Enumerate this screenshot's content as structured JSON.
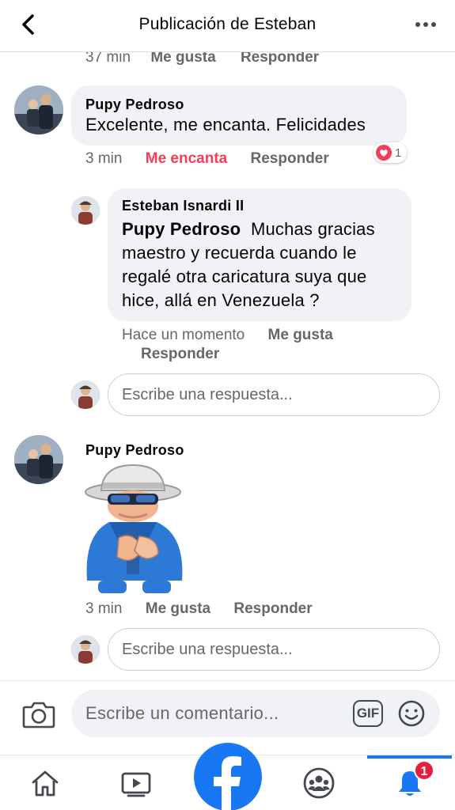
{
  "header": {
    "title": "Publicación de Esteban"
  },
  "top_meta": {
    "time": "37 min",
    "like": "Me gusta",
    "reply": "Responder"
  },
  "comments": [
    {
      "author": "Pupy Pedroso",
      "text": "Excelente, me encanta. Felicidades",
      "time": "3 min",
      "reaction_label": "Me encanta",
      "reply": "Responder",
      "reaction_count": "1"
    },
    {
      "author": "Pupy Pedroso",
      "time": "3 min",
      "like": "Me gusta",
      "reply": "Responder"
    }
  ],
  "reply": {
    "author": "Esteban Isnardi II",
    "mention": "Pupy Pedroso",
    "text": "Muchas gracias maestro y recuerda cuando le regalé otra caricatura suya que hice, allá en Venezuela ?",
    "time": "Hace un momento",
    "like": "Me gusta",
    "reply": "Responder"
  },
  "reply_inputs": {
    "placeholder": "Escribe una respuesta..."
  },
  "composer": {
    "placeholder": "Escribe un comentario...",
    "gif_label": "GIF"
  },
  "tabbar": {
    "notifications_count": "1"
  },
  "colors": {
    "brand": "#1877f2",
    "love": "#f33e58",
    "badge": "#e41e3f"
  },
  "icons": [
    "back-arrow-icon",
    "more-dots-icon",
    "heart-icon",
    "camera-icon",
    "gif-icon",
    "smiley-icon",
    "home-icon",
    "video-icon",
    "facebook-logo-icon",
    "groups-icon",
    "bell-icon"
  ]
}
